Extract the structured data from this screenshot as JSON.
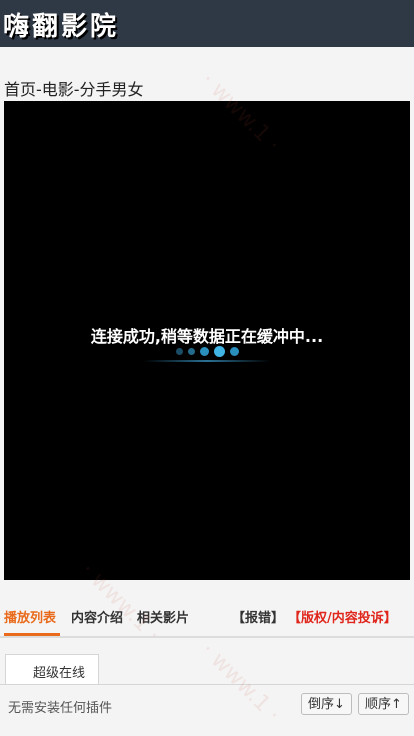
{
  "header": {
    "logo": "嗨翻影院"
  },
  "breadcrumb": "首页-电影-分手男女",
  "player": {
    "loading_text": "连接成功,稍等数据正在缓冲中..."
  },
  "tabs": {
    "playlist": "播放列表",
    "intro": "内容介绍",
    "related": "相关影片",
    "report": "【报错】",
    "complaint": "【版权/内容投诉】"
  },
  "source": {
    "name": "超级在线"
  },
  "hint": "无需安装任何插件",
  "sort": {
    "desc": "倒序↓",
    "asc": "顺序↑"
  },
  "colors": {
    "header_bg": "#2f3945",
    "accent": "#e86a1a",
    "complaint": "#e0251b"
  }
}
